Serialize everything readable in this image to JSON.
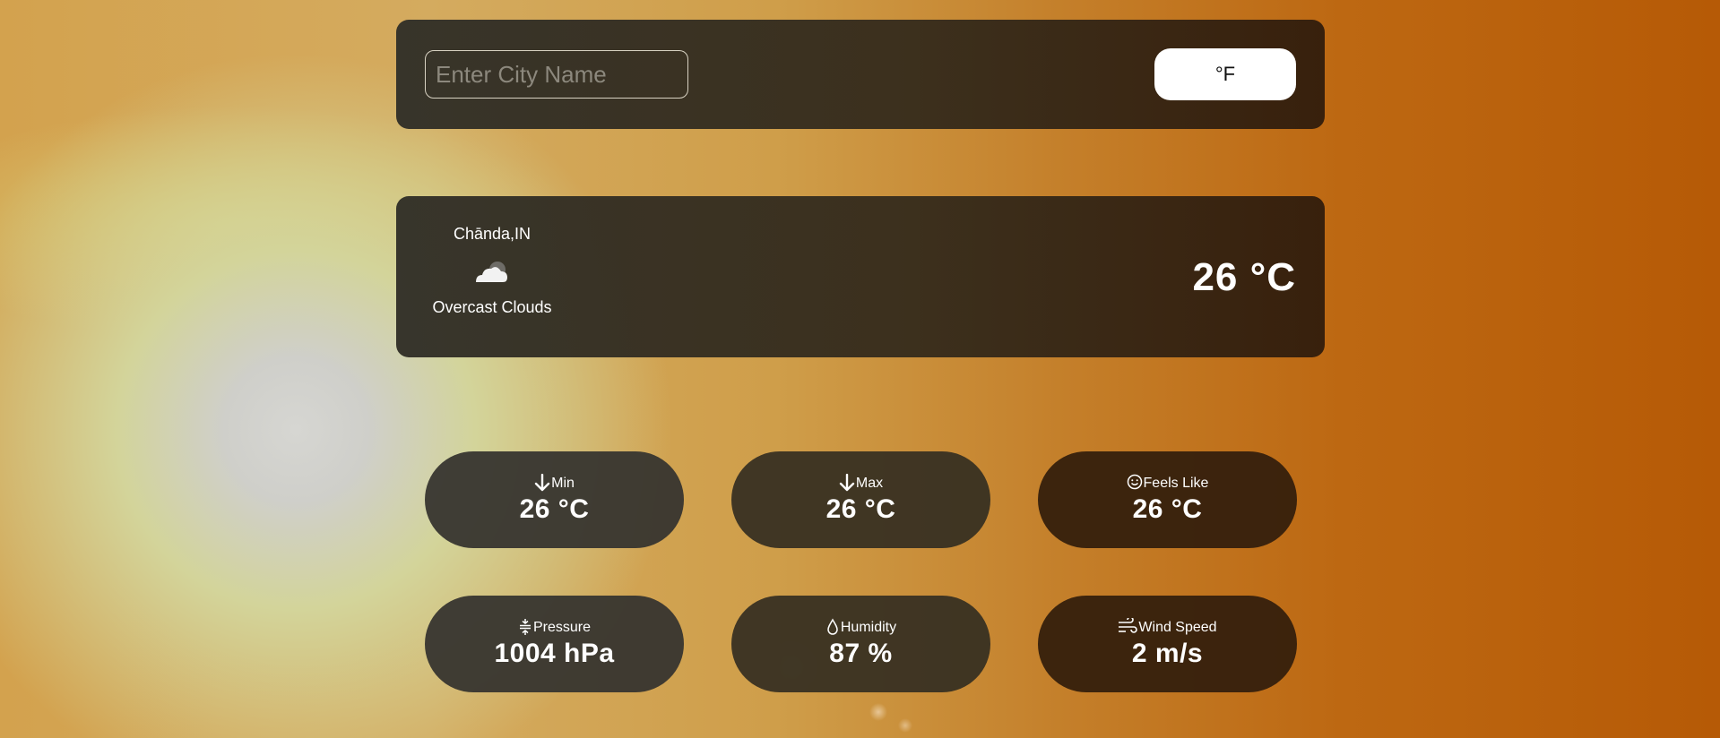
{
  "search": {
    "placeholder": "Enter City Name",
    "value": ""
  },
  "unit_toggle": {
    "label": "°F"
  },
  "current": {
    "location": "Chānda,IN",
    "condition": "Overcast Clouds",
    "icon": "cloud-icon",
    "temperature": "26 °C"
  },
  "stats": {
    "min": {
      "label": "Min",
      "value": "26 °C",
      "icon": "arrow-down-icon"
    },
    "max": {
      "label": "Max",
      "value": "26 °C",
      "icon": "arrow-down-icon"
    },
    "feels_like": {
      "label": "Feels Like",
      "value": "26 °C",
      "icon": "smiley-icon"
    },
    "pressure": {
      "label": "Pressure",
      "value": "1004 hPa",
      "icon": "pressure-icon"
    },
    "humidity": {
      "label": "Humidity",
      "value": "87 %",
      "icon": "droplet-icon"
    },
    "wind_speed": {
      "label": "Wind Speed",
      "value": "2 m/s",
      "icon": "wind-icon"
    }
  },
  "colors": {
    "panel": "#2f2a22",
    "toggle_bg": "#ffffff",
    "text": "#ffffff",
    "background_warm": "#b65a06"
  }
}
